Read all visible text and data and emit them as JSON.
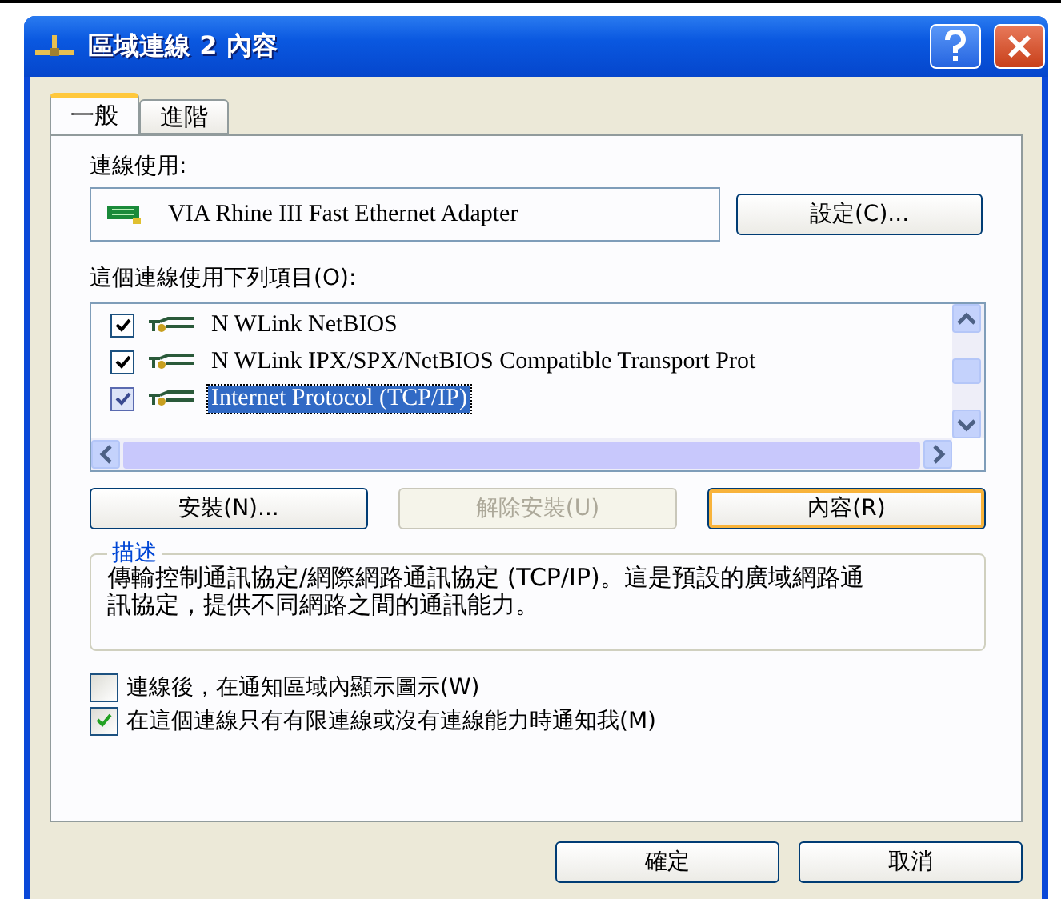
{
  "window": {
    "title": "區域連線 2 內容"
  },
  "tabs": [
    {
      "label": "一般",
      "selected": true
    },
    {
      "label": "進階",
      "selected": false
    }
  ],
  "connect_using": {
    "label": "連線使用:",
    "adapter": "VIA Rhine III Fast Ethernet Adapter",
    "button": "設定(C)..."
  },
  "components": {
    "label": "這個連線使用下列項目(O):",
    "items": [
      {
        "label": "N WLink NetBIOS",
        "checked": true,
        "selected": false
      },
      {
        "label": "N WLink IPX/SPX/NetBIOS Compatible Transport Prot",
        "checked": true,
        "selected": false
      },
      {
        "label": "Internet Protocol (TCP/IP)",
        "checked": true,
        "selected": true
      }
    ]
  },
  "component_buttons": [
    {
      "label": "安裝(N)...",
      "disabled": false,
      "focused": false
    },
    {
      "label": "解除安裝(U)",
      "disabled": true,
      "focused": false
    },
    {
      "label": "內容(R)",
      "disabled": false,
      "focused": true
    }
  ],
  "description": {
    "title": "描述",
    "text": "傳輸控制通訊協定/網際網路通訊協定 (TCP/IP)。這是預設的廣域網路通訊協定，提供不同網路之間的通訊能力。"
  },
  "options": [
    {
      "label": "連線後，在通知區域內顯示圖示(W)",
      "checked": false
    },
    {
      "label": "在這個連線只有有限連線或沒有連線能力時通知我(M)",
      "checked": true
    }
  ],
  "buttons": [
    "確定",
    "取消"
  ]
}
